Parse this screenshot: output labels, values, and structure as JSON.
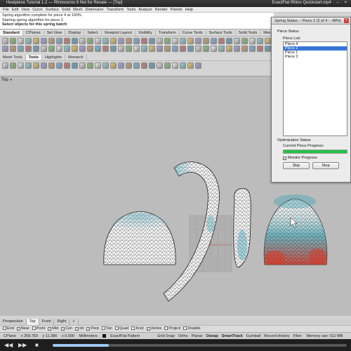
{
  "window": {
    "title": "Heatpiece Tutorial 1.2 — Rhinoceros 6 Not for Resale — [Top]",
    "video_title": "ExactFlat Rhino Quickstart.mp4",
    "close_glyph": "×",
    "min_glyph": "–"
  },
  "menubar": [
    "File",
    "Edit",
    "View",
    "Curve",
    "Surface",
    "Solid",
    "Mesh",
    "Dimension",
    "Transform",
    "Tools",
    "Analyze",
    "Render",
    "Panels",
    "Help"
  ],
  "command_history": [
    "Spring algorithm complete for piece 4 at 100%.",
    "Starting spring algorithm for piece 2.",
    "Select objects for this spring batch:"
  ],
  "toolbar_tabs": [
    "Standard",
    "CPlanes",
    "Set View",
    "Display",
    "Select",
    "Viewport Layout",
    "Visibility",
    "Transform",
    "Curve Tools",
    "Surface Tools",
    "Solid Tools",
    "Mesh Tools"
  ],
  "toolbar_tabs2": [
    "Mesh Tools",
    "Tools",
    "Highlights",
    "Monarch"
  ],
  "viewport": {
    "label": "Top",
    "dropdown_glyph": "▼"
  },
  "viewport_tabs": [
    "Perspective",
    "Top",
    "Front",
    "Right",
    "+"
  ],
  "osnap": [
    {
      "label": "End",
      "checked": false
    },
    {
      "label": "Near",
      "checked": true
    },
    {
      "label": "Point",
      "checked": false
    },
    {
      "label": "Mid",
      "checked": true
    },
    {
      "label": "Cen",
      "checked": true
    },
    {
      "label": "Int",
      "checked": true
    },
    {
      "label": "Perp",
      "checked": true
    },
    {
      "label": "Tan",
      "checked": false
    },
    {
      "label": "Quad",
      "checked": false
    },
    {
      "label": "Knot",
      "checked": false
    },
    {
      "label": "Vertex",
      "checked": true
    },
    {
      "label": "Project",
      "checked": false
    },
    {
      "label": "Disable",
      "checked": false
    }
  ],
  "statusbar": {
    "cplane": "CPlane",
    "x": "x 258.783",
    "y": "y 11.386",
    "z": "z 0.000",
    "units": "Millimeters",
    "layer": "ExactFlat Pattern",
    "toggles": [
      "Grid Snap",
      "Ortho",
      "Planar",
      "Osnap",
      "SmartTrack",
      "Gumball",
      "Record History",
      "Filter"
    ],
    "memory": "Memory use: 511 MB"
  },
  "player": {
    "play": "◀◀",
    "pause": "▶▶",
    "stop": "■",
    "progress": 0.19
  },
  "dialog": {
    "title": "Spring Status -- Piece 2 (2 of 4 -- 48%)",
    "close": "×",
    "piece_status": "Piece Status",
    "piece_list_label": "Piece List:",
    "pieces": [
      "Piece 4",
      "Piece 2",
      "Piece 1",
      "Piece 3"
    ],
    "selected_index": 1,
    "optimization_status": "Optimization Status",
    "current_piece_progress": "Current Piece Progress:",
    "progress": 1.0,
    "monitor_progress": "Monitor Progress",
    "monitor_checked": "✓",
    "skip": "Skip",
    "stop": "Stop"
  },
  "colors": {
    "viewport_bg": "#bcbcbc",
    "mesh_fill": "#f7f7f7",
    "mesh_line": "#2a2a2a",
    "strain_blue": "#3b9fb3",
    "strain_red": "#d53a2a",
    "progress_green": "#24c449",
    "selection_blue": "#3875d7"
  }
}
